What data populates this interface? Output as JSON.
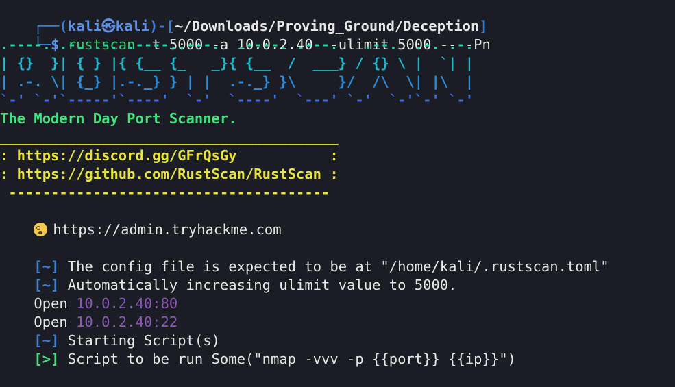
{
  "prompt": {
    "corner_top": "┌──",
    "open": "(",
    "user": "kali",
    "at_symbol": "㉿",
    "host": "kali",
    "close_bracket_open": ")-[",
    "path": "~/Downloads/Proving_Ground/Deception",
    "path_close": "]",
    "corner_bottom": "└─",
    "dollar": "$",
    "command": "rustscan",
    "args": " -t 5000 -a 10.0.2.40 --ulimit 5000 -- -Pn"
  },
  "banner": {
    "art": [
      ".----. .-. .-. .----..---.  .----. .---.   .--.  .-. .-.",
      "| {}  }| { } |{ {__ {_   _}{ {__  /  ___} / {} \\ |  `| |",
      "| .-. \\| {_} |.-._} } | |  .-._} }\\     }/  /\\  \\| |\\  |",
      "`-' `-'`-----'`----'  `-'  `----'  `---' `-'  `-'`-' `-'"
    ],
    "tagline": "The Modern Day Port Scanner."
  },
  "links_box": {
    "top_border": "________________________________________",
    "discord": ": https://discord.gg/GFrQsGy           :",
    "github": ": https://github.com/RustScan/RustScan :",
    "bottom_border": " --------------------------------------"
  },
  "quote": {
    "icon": "dizzy-face-emoji",
    "text": "https://admin.tryhackme.com"
  },
  "output": [
    {
      "prefix": "[~]",
      "text": " The config file is expected to be at \"/home/kali/.rustscan.toml\""
    },
    {
      "prefix": "[~]",
      "text": " Automatically increasing ulimit value to 5000."
    },
    {
      "label": "Open ",
      "addr": "10.0.2.40:80"
    },
    {
      "label": "Open ",
      "addr": "10.0.2.40:22"
    },
    {
      "prefix": "[~]",
      "text": " Starting Script(s)"
    },
    {
      "prefix": "[>]",
      "text": " Script to be run Some(\"nmap -vvv -p {{port}} {{ip}}\")"
    }
  ],
  "colors": {
    "background": "#1b1d24",
    "prompt_blue": "#3f7cd6",
    "green": "#2fd36e",
    "yellow": "#e8e33b",
    "purple": "#8a57b5"
  }
}
